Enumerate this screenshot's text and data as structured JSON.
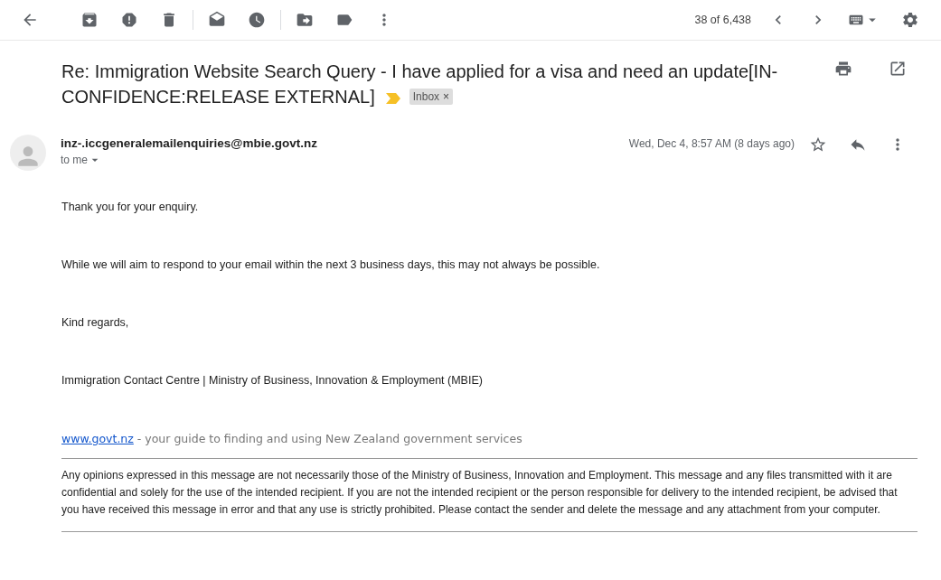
{
  "toolbar": {
    "pager": "38 of 6,438"
  },
  "message": {
    "subject": "Re: Immigration Website Search Query - I have applied for a visa and need an update[IN-CONFIDENCE:RELEASE EXTERNAL]",
    "labels": [
      {
        "label": "Inbox",
        "remove": "×"
      }
    ],
    "sender": "inz-.iccgeneralemailenquiries@mbie.govt.nz",
    "recipient": "to me",
    "date": "Wed, Dec 4, 8:57 AM (8 days ago)",
    "body": [
      "Thank you for your enquiry.",
      "While we will aim to respond to your email within the next 3 business days, this may not always be possible.",
      "Kind regards,",
      "Immigration Contact Centre | Ministry of Business, Innovation & Employment (MBIE)"
    ],
    "footer": {
      "link": "www.govt.nz",
      "tagline": " - your guide to finding and using New Zealand government services"
    },
    "disclaimer": "Any opinions expressed in this message are not necessarily those of the Ministry of Business, Innovation and Employment. This message and any files transmitted with it are confidential and solely for the use of the intended recipient. If you are not the intended recipient or the person responsible for delivery to the intended recipient, be advised that you have received this message in error and that any use is strictly prohibited. Please contact the sender and delete the message and any attachment from your computer."
  }
}
